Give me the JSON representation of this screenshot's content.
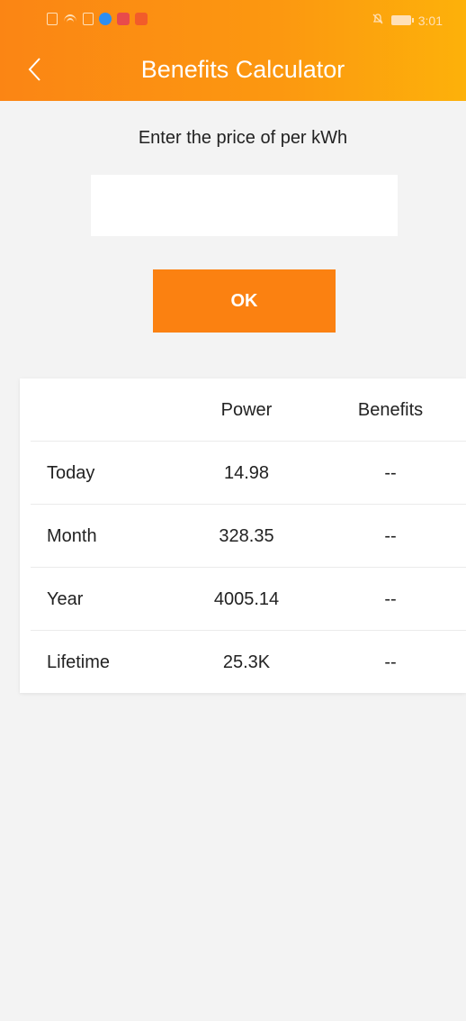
{
  "status_bar": {
    "time": "3:01"
  },
  "header": {
    "title": "Benefits Calculator"
  },
  "form": {
    "prompt": "Enter the price of per kWh",
    "price_value": "",
    "ok_label": "OK"
  },
  "table": {
    "headers": {
      "label": "",
      "power": "Power",
      "benefits": "Benefits"
    },
    "rows": [
      {
        "label": "Today",
        "power": "14.98",
        "benefits": "--"
      },
      {
        "label": "Month",
        "power": "328.35",
        "benefits": "--"
      },
      {
        "label": "Year",
        "power": "4005.14",
        "benefits": "--"
      },
      {
        "label": "Lifetime",
        "power": "25.3K",
        "benefits": "--"
      }
    ]
  },
  "colors": {
    "header_gradient_start": "#fb8514",
    "header_gradient_end": "#fdb10a",
    "button": "#fb8111",
    "background": "#f3f3f3"
  },
  "icons": {
    "back": "chevron-left-icon",
    "mute": "bell-off-icon",
    "battery": "battery-icon"
  }
}
